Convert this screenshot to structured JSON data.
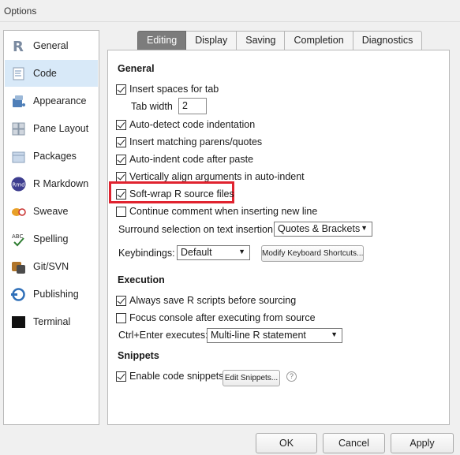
{
  "window": {
    "title": "Options"
  },
  "sidebar": {
    "items": [
      {
        "label": "General",
        "icon": "r-logo-icon"
      },
      {
        "label": "Code",
        "icon": "code-document-icon",
        "selected": true
      },
      {
        "label": "Appearance",
        "icon": "paint-bucket-icon"
      },
      {
        "label": "Pane Layout",
        "icon": "pane-layout-icon"
      },
      {
        "label": "Packages",
        "icon": "package-box-icon"
      },
      {
        "label": "R Markdown",
        "icon": "rmd-icon",
        "badge": "Rmd"
      },
      {
        "label": "Sweave",
        "icon": "sweave-icon"
      },
      {
        "label": "Spelling",
        "icon": "abc-check-icon",
        "badge": "ABC"
      },
      {
        "label": "Git/SVN",
        "icon": "git-svn-icon"
      },
      {
        "label": "Publishing",
        "icon": "publishing-icon"
      },
      {
        "label": "Terminal",
        "icon": "terminal-icon"
      }
    ]
  },
  "tabs": [
    "Editing",
    "Display",
    "Saving",
    "Completion",
    "Diagnostics"
  ],
  "active_tab": "Editing",
  "general": {
    "heading": "General",
    "insert_spaces": {
      "label": "Insert spaces for tab",
      "checked": true
    },
    "tab_width_label": "Tab width",
    "tab_width_value": "2",
    "auto_detect": {
      "label": "Auto-detect code indentation",
      "checked": true
    },
    "matching_parens": {
      "label": "Insert matching parens/quotes",
      "checked": true
    },
    "auto_indent": {
      "label": "Auto-indent code after paste",
      "checked": true
    },
    "vertical_align": {
      "label": "Vertically align arguments in auto-indent",
      "checked": true
    },
    "soft_wrap": {
      "label": "Soft-wrap R source files",
      "checked": true
    },
    "continue_comment": {
      "label": "Continue comment when inserting new line",
      "checked": false
    },
    "surround_label": "Surround selection on text insertion:",
    "surround_value": "Quotes & Brackets",
    "keybindings_label": "Keybindings:",
    "keybindings_value": "Default",
    "modify_shortcuts": "Modify Keyboard Shortcuts..."
  },
  "execution": {
    "heading": "Execution",
    "always_save": {
      "label": "Always save R scripts before sourcing",
      "checked": true
    },
    "focus_console": {
      "label": "Focus console after executing from source",
      "checked": false
    },
    "ctrl_enter_label": "Ctrl+Enter executes:",
    "ctrl_enter_value": "Multi-line R statement"
  },
  "snippets": {
    "heading": "Snippets",
    "enable": {
      "label": "Enable code snippets",
      "checked": true
    },
    "edit_button": "Edit Snippets...",
    "help": "?"
  },
  "buttons": {
    "ok": "OK",
    "cancel": "Cancel",
    "apply": "Apply"
  },
  "colors": {
    "highlight": "#e0232f",
    "selected_row": "#d8e9f8",
    "active_tab": "#7c7c7c"
  }
}
